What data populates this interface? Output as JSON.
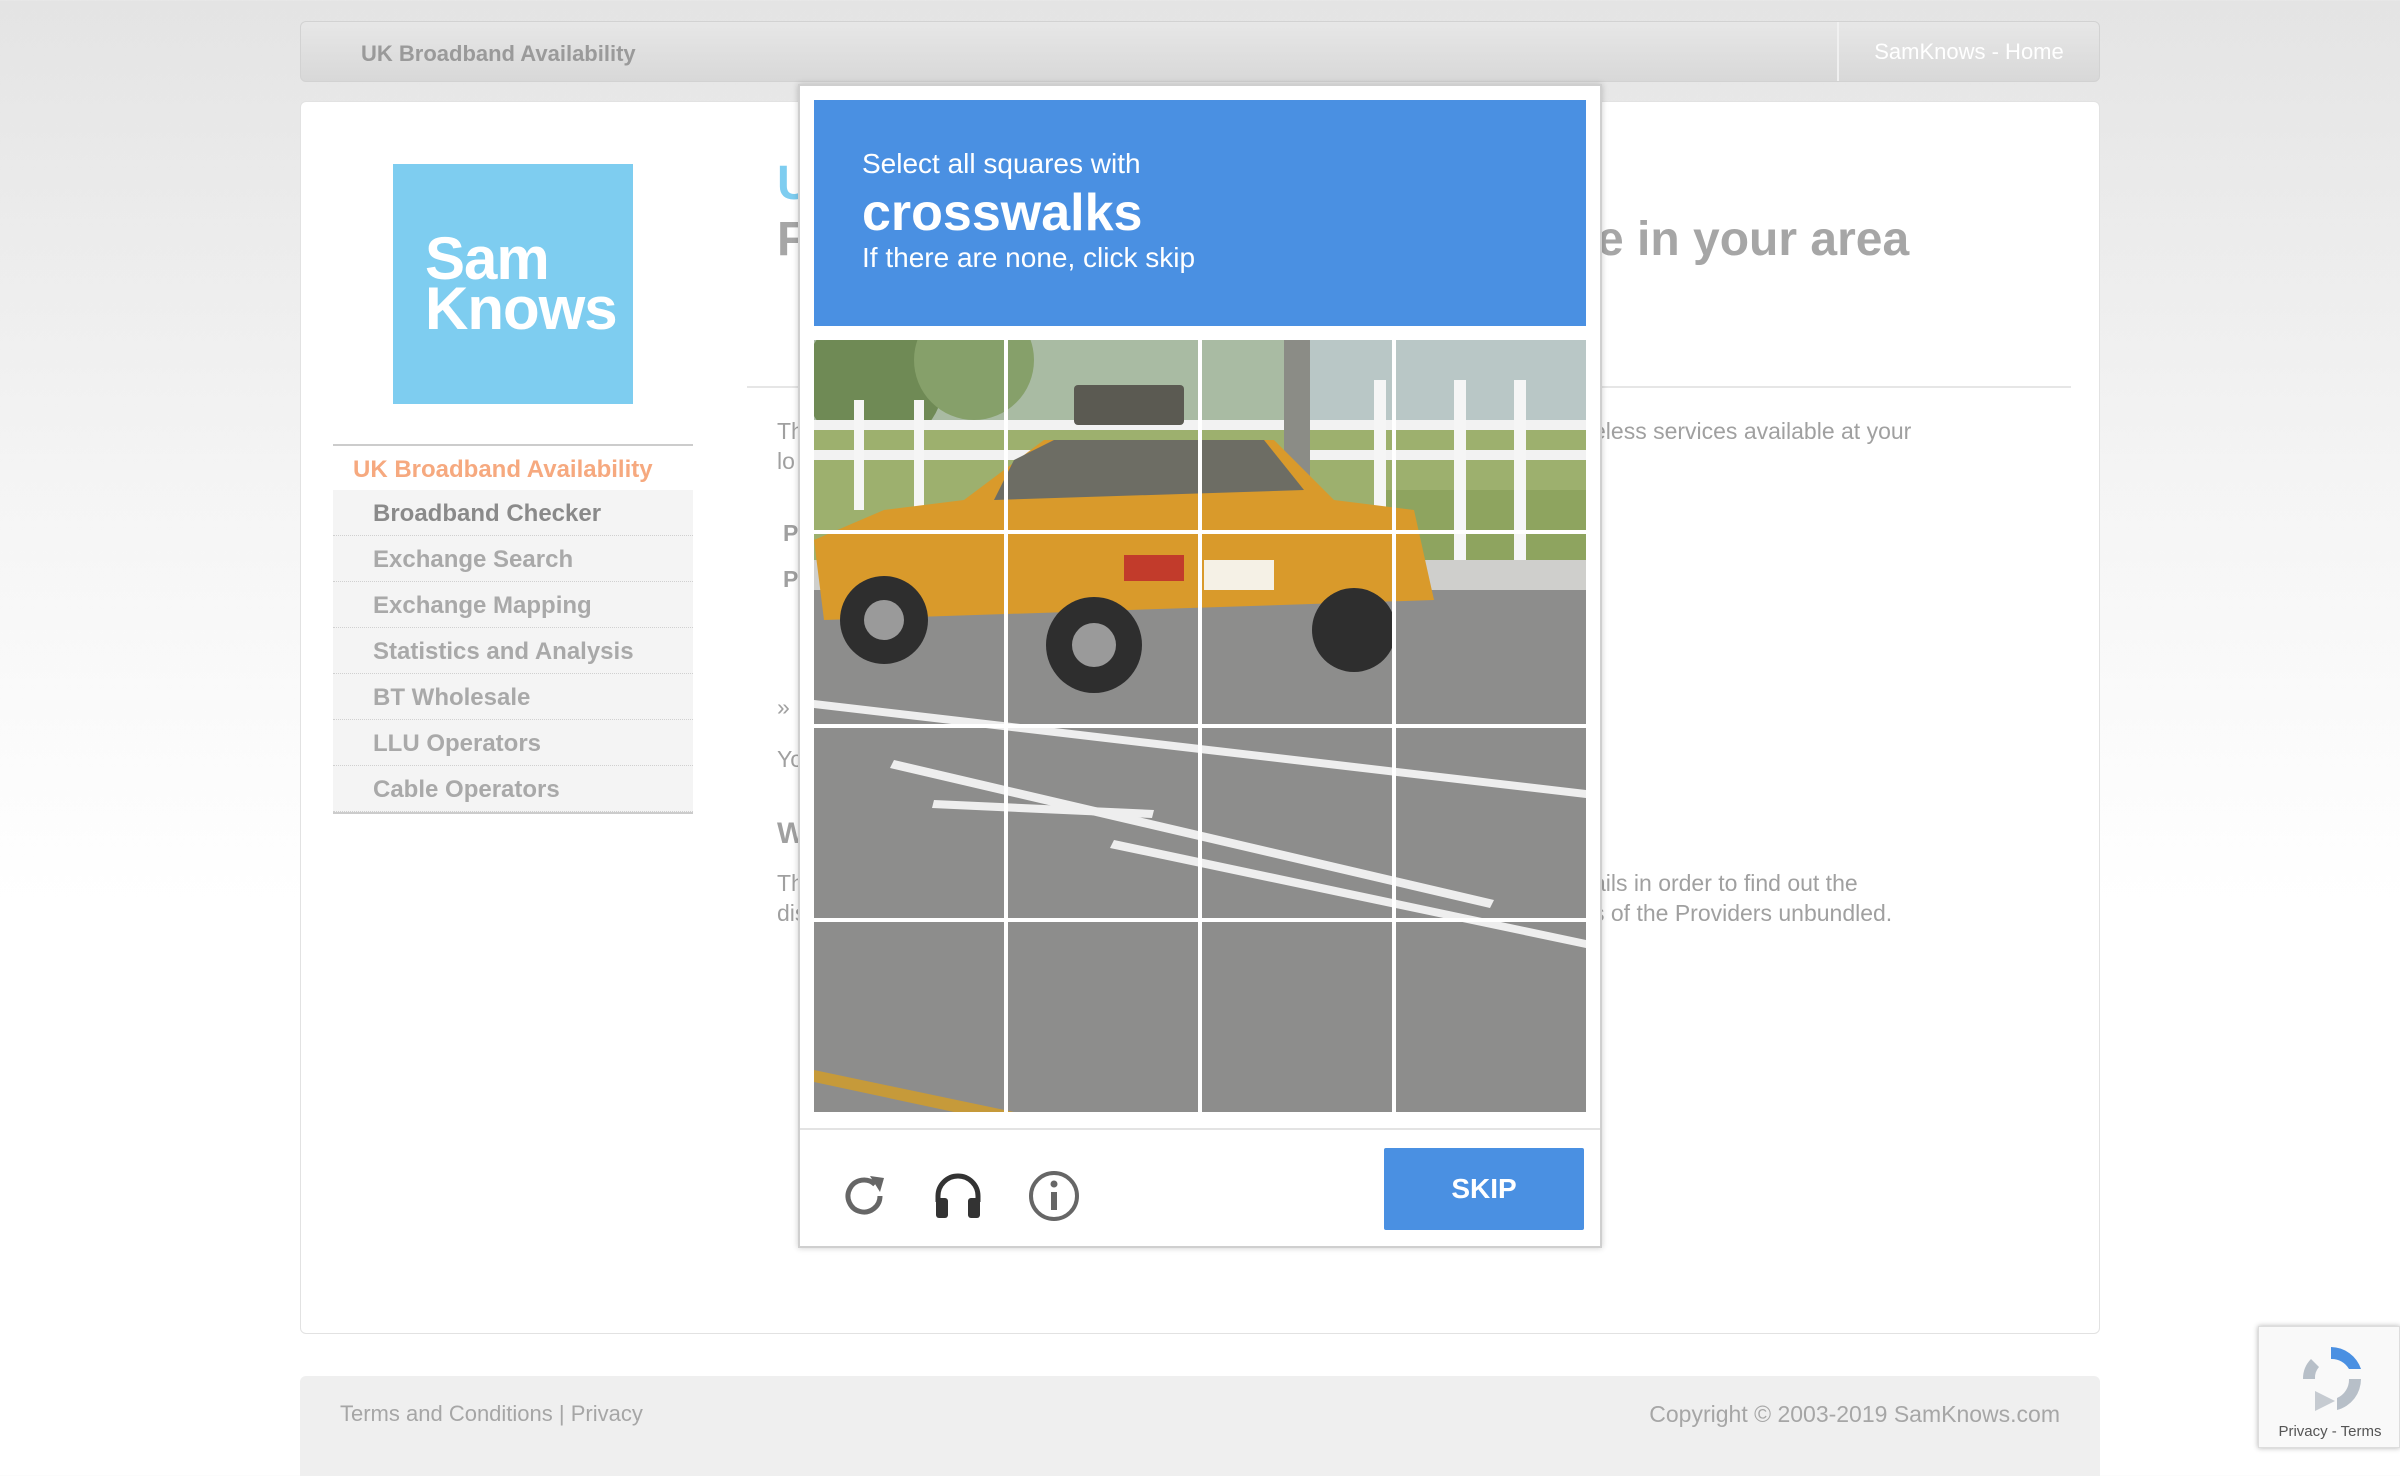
{
  "topbar": {
    "site_title": "UK Broadband Availability",
    "home_link": "SamKnows - Home"
  },
  "logo": {
    "line1": "Sam",
    "line2": "Knows"
  },
  "sidebar": {
    "heading": "UK Broadband Availability",
    "items": [
      {
        "label": "Broadband Checker"
      },
      {
        "label": "Exchange Search"
      },
      {
        "label": "Exchange Mapping"
      },
      {
        "label": "Statistics and Analysis"
      },
      {
        "label": "BT Wholesale"
      },
      {
        "label": "LLU Operators"
      },
      {
        "label": "Cable Operators"
      }
    ]
  },
  "content": {
    "title_partial_1": "U",
    "title_partial_2": "F",
    "title_right": "e in your area",
    "para1_left_a": "Th",
    "para1_left_b": "lo",
    "para1_right": "eless services available at your",
    "label_p1": "P",
    "label_p2": "P",
    "arrow": "»",
    "yo": "Yo",
    "heading_w": "W",
    "para2_left_a": "Th",
    "para2_left_b": "dis",
    "para2_right_a": "ails in order to find out the",
    "para2_right_b": "s of the Providers unbundled."
  },
  "captcha": {
    "instruction": "Select all squares with",
    "target": "crosswalks",
    "hint": "If there are none, click skip",
    "skip_label": "SKIP",
    "icons": [
      "reload-icon",
      "headphones-icon",
      "info-icon"
    ]
  },
  "footer": {
    "terms": "Terms and Conditions",
    "separator": "|",
    "privacy": "Privacy",
    "copyright": "Copyright © 2003-2019 SamKnows.com"
  },
  "recaptcha_badge": {
    "text": "Privacy - Terms"
  },
  "colors": {
    "captcha_blue": "#4a90e2",
    "logo_blue": "#7ecdf0",
    "sidebar_heading": "#f6a97f"
  }
}
